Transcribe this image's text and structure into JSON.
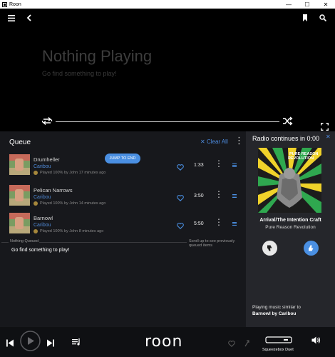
{
  "window": {
    "title": "Roon",
    "minimize": "—",
    "maximize": "☐",
    "close": "✕"
  },
  "now_playing": {
    "title": "Nothing Playing",
    "subtitle": "Go find something to play!"
  },
  "queue": {
    "header": "Queue",
    "clear_all": "Clear All",
    "jump_button": "JUMP TO END",
    "items": [
      {
        "title": "Drumheller",
        "artist": "Caribou",
        "meta": "Played 100% by John 17 minutes ago",
        "duration": "1:33"
      },
      {
        "title": "Pelican Narrows",
        "artist": "Caribou",
        "meta": "Played 100% by John 14 minutes ago",
        "duration": "3:50"
      },
      {
        "title": "Barnowl",
        "artist": "Caribou",
        "meta": "Played 100% by John 8 minutes ago",
        "duration": "5:50"
      }
    ],
    "nothing_queued": "Nothing Queued",
    "scroll_hint": "Scroll up to see previously queued items",
    "find_play": "Go find something to play!"
  },
  "radio": {
    "title": "Radio continues in 0:00",
    "album_title": "Arrival/The Intention Craft",
    "album_artist": "Pure Reason Revolution",
    "cover_text_1": "PURE REASON",
    "cover_text_2": "REVOLUTION",
    "similar_label": "Playing music similar to",
    "similar_value": "Barnowl by Caribou"
  },
  "footer": {
    "logo": "roon",
    "zone": "Squeezebox Duet"
  },
  "colors": {
    "accent": "#4a8fe2",
    "queue_bg": "#17181c",
    "radio_bg": "#25262b"
  }
}
